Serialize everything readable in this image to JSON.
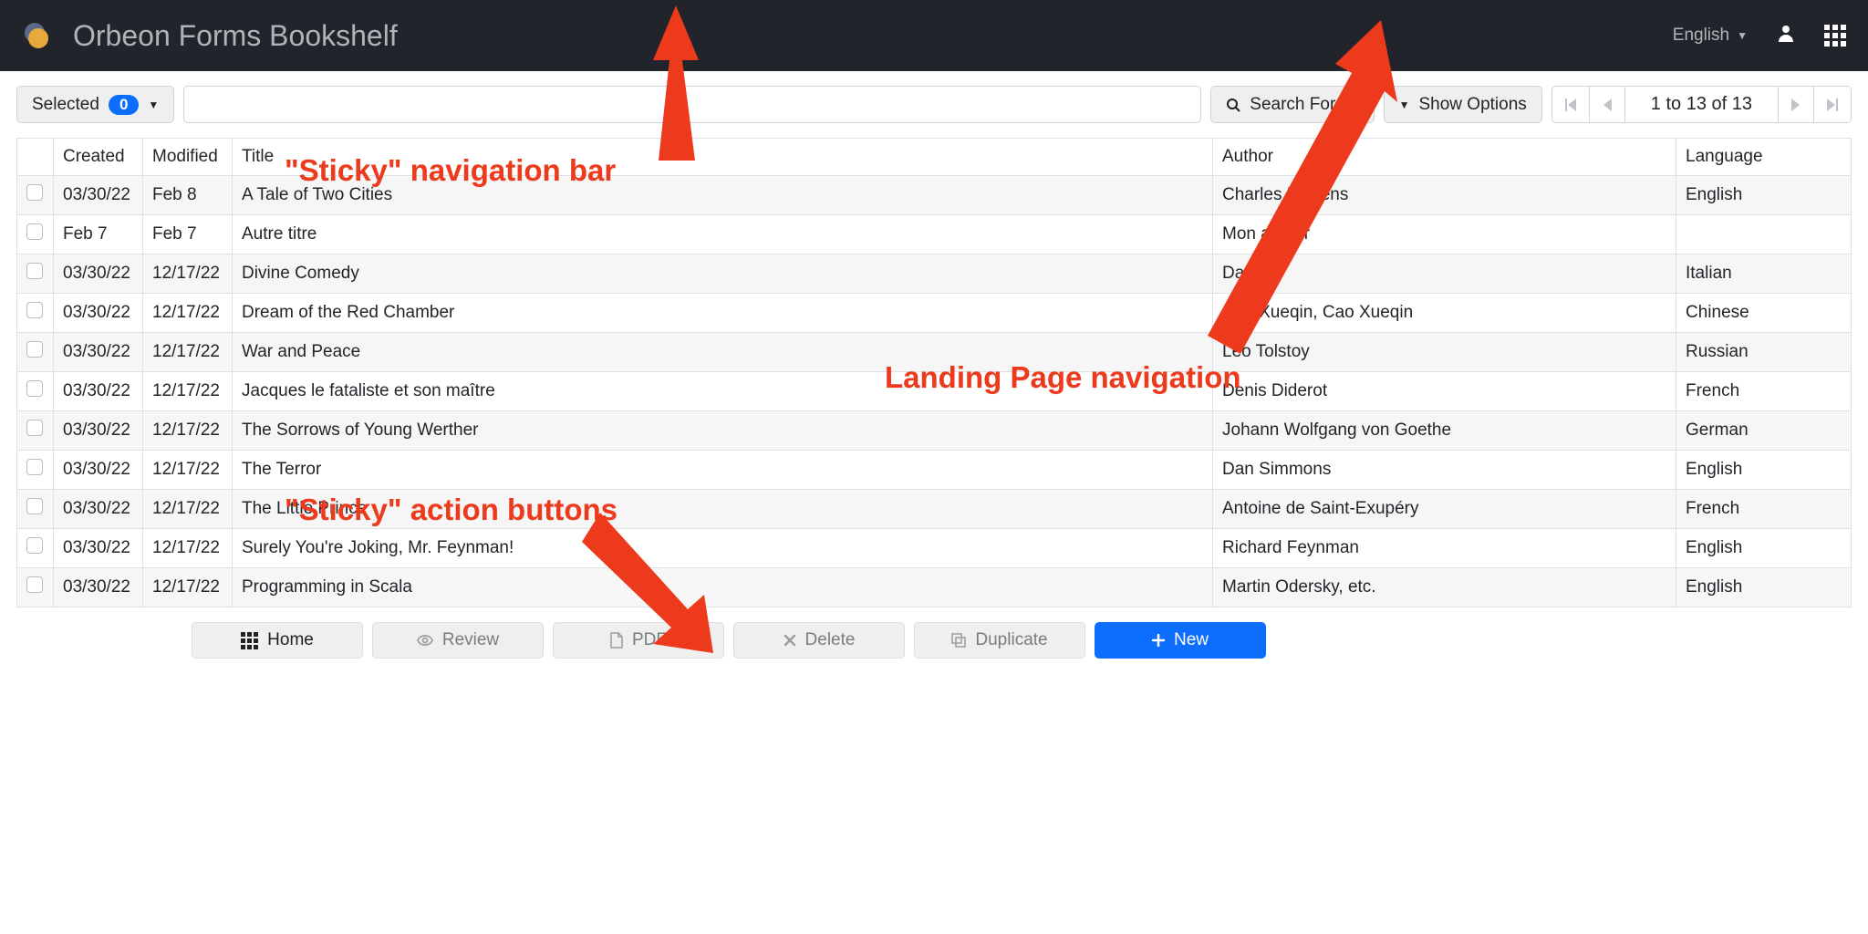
{
  "header": {
    "title": "Orbeon Forms Bookshelf",
    "language": "English"
  },
  "toolbar": {
    "selected_label": "Selected",
    "selected_count": "0",
    "search_button": "Search Forms",
    "show_options": "Show Options",
    "pager_status": "1 to 13 of 13"
  },
  "columns": {
    "created": "Created",
    "modified": "Modified",
    "title": "Title",
    "author": "Author",
    "language": "Language"
  },
  "rows": [
    {
      "created": "03/30/22",
      "modified": "Feb 8",
      "title": "A Tale of Two Cities",
      "author": "Charles Dickens",
      "language": "English"
    },
    {
      "created": "Feb 7",
      "modified": "Feb 7",
      "title": "Autre titre",
      "author": "Mon auteur",
      "language": ""
    },
    {
      "created": "03/30/22",
      "modified": "12/17/22",
      "title": "Divine Comedy",
      "author": "Dante",
      "language": "Italian"
    },
    {
      "created": "03/30/22",
      "modified": "12/17/22",
      "title": "Dream of the Red Chamber",
      "author": "Cao Xueqin, Cao Xueqin",
      "language": "Chinese"
    },
    {
      "created": "03/30/22",
      "modified": "12/17/22",
      "title": "War and Peace",
      "author": "Leo Tolstoy",
      "language": "Russian"
    },
    {
      "created": "03/30/22",
      "modified": "12/17/22",
      "title": "Jacques le fataliste et son maître",
      "author": "Denis Diderot",
      "language": "French"
    },
    {
      "created": "03/30/22",
      "modified": "12/17/22",
      "title": "The Sorrows of Young Werther",
      "author": "Johann Wolfgang von Goethe",
      "language": "German"
    },
    {
      "created": "03/30/22",
      "modified": "12/17/22",
      "title": "The Terror",
      "author": "Dan Simmons",
      "language": "English"
    },
    {
      "created": "03/30/22",
      "modified": "12/17/22",
      "title": "The Little Prince",
      "author": "Antoine de Saint-Exupéry",
      "language": "French"
    },
    {
      "created": "03/30/22",
      "modified": "12/17/22",
      "title": "Surely You're Joking, Mr. Feynman!",
      "author": "Richard Feynman",
      "language": "English"
    },
    {
      "created": "03/30/22",
      "modified": "12/17/22",
      "title": "Programming in Scala",
      "author": "Martin Odersky, etc.",
      "language": "English"
    }
  ],
  "actions": {
    "home": "Home",
    "review": "Review",
    "pdf": "PDF",
    "delete": "Delete",
    "duplicate": "Duplicate",
    "new": "New"
  },
  "annotations": {
    "sticky_nav": "\"Sticky\" navigation bar",
    "landing_nav": "Landing Page navigation",
    "sticky_actions": "\"Sticky\" action buttons"
  }
}
